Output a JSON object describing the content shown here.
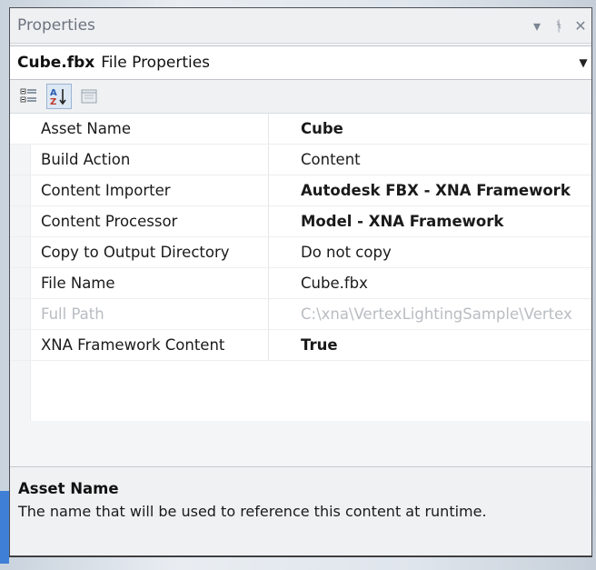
{
  "window": {
    "title": "Properties",
    "buttons": {
      "dropdown": "▾",
      "pin": "ᚬ",
      "close": "✕"
    }
  },
  "object_selector": {
    "name": "Cube.fbx",
    "type": "File Properties"
  },
  "toolbar": {
    "buttons": [
      "categorized-icon",
      "alphabetical-icon",
      "property-pages-icon"
    ]
  },
  "properties": [
    {
      "name": "Asset Name",
      "value": "Cube",
      "bold": true,
      "disabled": false
    },
    {
      "name": "Build Action",
      "value": "Content",
      "bold": false,
      "disabled": false
    },
    {
      "name": "Content Importer",
      "value": "Autodesk FBX - XNA Framework",
      "bold": true,
      "disabled": false
    },
    {
      "name": "Content Processor",
      "value": "Model - XNA Framework",
      "bold": true,
      "disabled": false
    },
    {
      "name": "Copy to Output Directory",
      "value": "Do not copy",
      "bold": false,
      "disabled": false
    },
    {
      "name": "File Name",
      "value": "Cube.fbx",
      "bold": false,
      "disabled": false
    },
    {
      "name": "Full Path",
      "value": "C:\\xna\\VertexLightingSample\\Vertex",
      "bold": false,
      "disabled": true
    },
    {
      "name": "XNA Framework Content",
      "value": "True",
      "bold": true,
      "disabled": false
    }
  ],
  "description": {
    "title": "Asset Name",
    "text": "The name that will be used to reference this content at runtime."
  },
  "colors": {
    "panel_bg": "#f4f5f6",
    "title_text": "#6d7480",
    "disabled_text": "#b9bcc1",
    "accent": "#3f7fd6"
  }
}
